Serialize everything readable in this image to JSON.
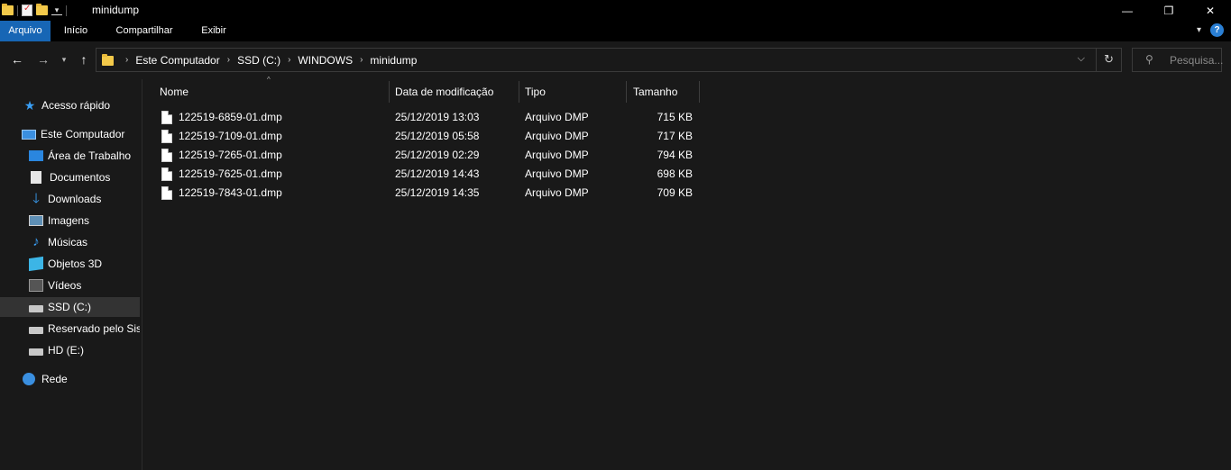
{
  "window": {
    "title": "minidump",
    "controls": {
      "minimize": "—",
      "maximize": "❐",
      "close": "✕"
    }
  },
  "ribbon": {
    "tabs": [
      {
        "label": "Arquivo",
        "active": true
      },
      {
        "label": "Início"
      },
      {
        "label": "Compartilhar"
      },
      {
        "label": "Exibir"
      }
    ],
    "help_icon": "?"
  },
  "address": {
    "breadcrumbs": [
      "Este Computador",
      "SSD (C:)",
      "WINDOWS",
      "minidump"
    ],
    "search_placeholder": "Pesquisa..."
  },
  "sidebar": {
    "items": [
      {
        "label": "Acesso rápido",
        "icon": "star-icon"
      },
      {
        "label": "Este Computador",
        "icon": "computer-icon"
      },
      {
        "label": "Área de Trabalho",
        "icon": "desktop-icon"
      },
      {
        "label": "Documentos",
        "icon": "documents-icon"
      },
      {
        "label": "Downloads",
        "icon": "downloads-icon"
      },
      {
        "label": "Imagens",
        "icon": "pictures-icon"
      },
      {
        "label": "Músicas",
        "icon": "music-icon"
      },
      {
        "label": "Objetos 3D",
        "icon": "3d-objects-icon"
      },
      {
        "label": "Vídeos",
        "icon": "videos-icon"
      },
      {
        "label": "SSD (C:)",
        "icon": "drive-icon",
        "selected": true
      },
      {
        "label": "Reservado pelo Sistema",
        "icon": "drive-icon"
      },
      {
        "label": "HD (E:)",
        "icon": "drive-icon"
      },
      {
        "label": "Rede",
        "icon": "network-icon"
      }
    ]
  },
  "columns": {
    "name": "Nome",
    "date": "Data de modificação",
    "type": "Tipo",
    "size": "Tamanho"
  },
  "files": [
    {
      "name": "122519-6859-01.dmp",
      "date": "25/12/2019 13:03",
      "type": "Arquivo DMP",
      "size": "715 KB"
    },
    {
      "name": "122519-7109-01.dmp",
      "date": "25/12/2019 05:58",
      "type": "Arquivo DMP",
      "size": "717 KB"
    },
    {
      "name": "122519-7265-01.dmp",
      "date": "25/12/2019 02:29",
      "type": "Arquivo DMP",
      "size": "794 KB"
    },
    {
      "name": "122519-7625-01.dmp",
      "date": "25/12/2019 14:43",
      "type": "Arquivo DMP",
      "size": "698 KB"
    },
    {
      "name": "122519-7843-01.dmp",
      "date": "25/12/2019 14:35",
      "type": "Arquivo DMP",
      "size": "709 KB"
    }
  ]
}
